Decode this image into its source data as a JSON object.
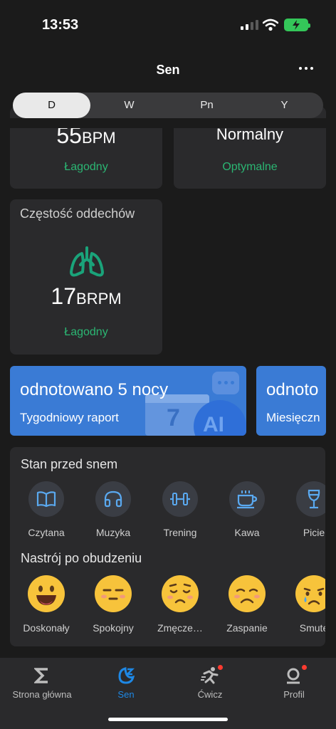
{
  "status_bar": {
    "time": "13:53"
  },
  "header": {
    "title": "Sen"
  },
  "segments": [
    {
      "label": "D",
      "active": true
    },
    {
      "label": "W",
      "active": false
    },
    {
      "label": "Pn",
      "active": false
    },
    {
      "label": "Y",
      "active": false
    }
  ],
  "heart_card": {
    "value": "55",
    "unit": "BPM",
    "status": "Łagodny"
  },
  "spo2_card": {
    "value": "Normalny",
    "status": "Optymalne"
  },
  "respiration_card": {
    "title": "Częstość oddechów",
    "value": "17",
    "unit": "BRPM",
    "status": "Łagodny"
  },
  "reports": [
    {
      "title": "odnotowano 5 nocy",
      "subtitle": "Tygodniowy raport"
    },
    {
      "title": "odnoto",
      "subtitle": "Miesięczn"
    }
  ],
  "report_badge": "AI",
  "pre_sleep": {
    "title": "Stan przed snem",
    "habits": [
      {
        "label": "Czytana",
        "icon": "book-icon"
      },
      {
        "label": "Muzyka",
        "icon": "headphones-icon"
      },
      {
        "label": "Trening",
        "icon": "dumbbell-icon"
      },
      {
        "label": "Kawa",
        "icon": "coffee-icon"
      },
      {
        "label": "Picie",
        "icon": "wine-glass-icon"
      }
    ],
    "mood_title": "Nastrój po obudzeniu",
    "moods": [
      {
        "label": "Doskonały",
        "icon": "grinning-face-icon"
      },
      {
        "label": "Spokojny",
        "icon": "calm-face-icon"
      },
      {
        "label": "Zmęcze…",
        "icon": "tired-face-icon"
      },
      {
        "label": "Zaspanie",
        "icon": "sleepy-face-icon"
      },
      {
        "label": "Smute",
        "icon": "sad-face-icon"
      }
    ]
  },
  "tabbar": [
    {
      "label": "Strona główna",
      "icon": "sigma-icon",
      "active": false
    },
    {
      "label": "Sen",
      "icon": "moon-icon",
      "active": true
    },
    {
      "label": "Ćwicz",
      "icon": "runner-icon",
      "active": false,
      "badge": true
    },
    {
      "label": "Profil",
      "icon": "profile-icon",
      "active": false,
      "badge": true
    }
  ],
  "colors": {
    "accent": "#1e88e5",
    "green": "#2bb673",
    "report_blue": "#3a7bd5",
    "emoji_yellow": "#f7c33b",
    "badge_red": "#ff3b30"
  }
}
